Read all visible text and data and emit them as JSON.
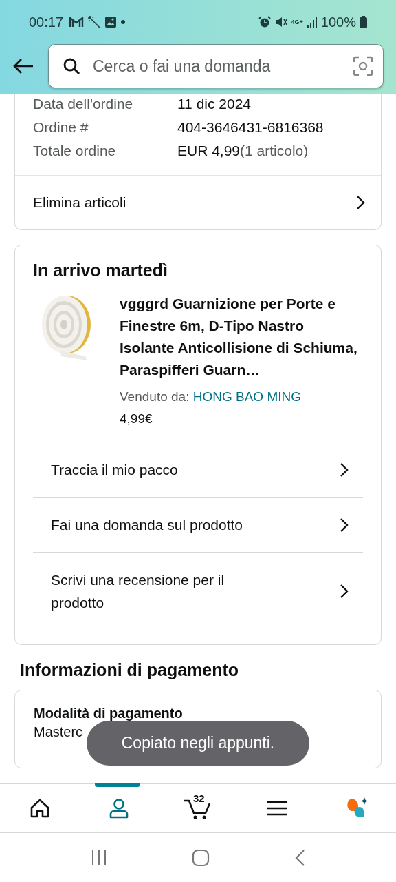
{
  "status_bar": {
    "time": "00:17",
    "network": "4G+",
    "battery": "100%"
  },
  "search": {
    "placeholder": "Cerca o fai una domanda"
  },
  "order_summary": {
    "rows": [
      {
        "label": "Data dell'ordine",
        "value": "11 dic 2024"
      },
      {
        "label": "Ordine #",
        "value": "404-3646431-6816368"
      },
      {
        "label": "Totale ordine",
        "value": "EUR 4,99",
        "note": "(1 articolo)"
      }
    ],
    "action": "Elimina articoli"
  },
  "shipment": {
    "heading": "In arrivo martedì",
    "product": {
      "kind": "picture",
      "title": "vgggrd Guarnizione per Porte e Finestre 6m, D-Tipo Nastro Isolante Anticollisione di Schiuma, Paraspifferi Guarn…",
      "seller_label": "Venduto da:",
      "seller": "HONG BAO MING",
      "price": "4,99€"
    },
    "actions": [
      "Traccia il mio pacco",
      "Fai una domanda sul prodotto",
      "Scrivi una recensione per il prodotto"
    ]
  },
  "payment": {
    "heading": "Informazioni di pagamento",
    "method_label": "Modalità di pagamento",
    "method": "Masterc"
  },
  "toast": "Copiato negli appunti.",
  "bottom_nav": [
    {
      "kind": "home",
      "selected": false
    },
    {
      "kind": "account",
      "selected": true
    },
    {
      "kind": "cart",
      "selected": false,
      "count": "32"
    },
    {
      "kind": "menu",
      "selected": false
    },
    {
      "kind": "assistant",
      "selected": false
    }
  ]
}
